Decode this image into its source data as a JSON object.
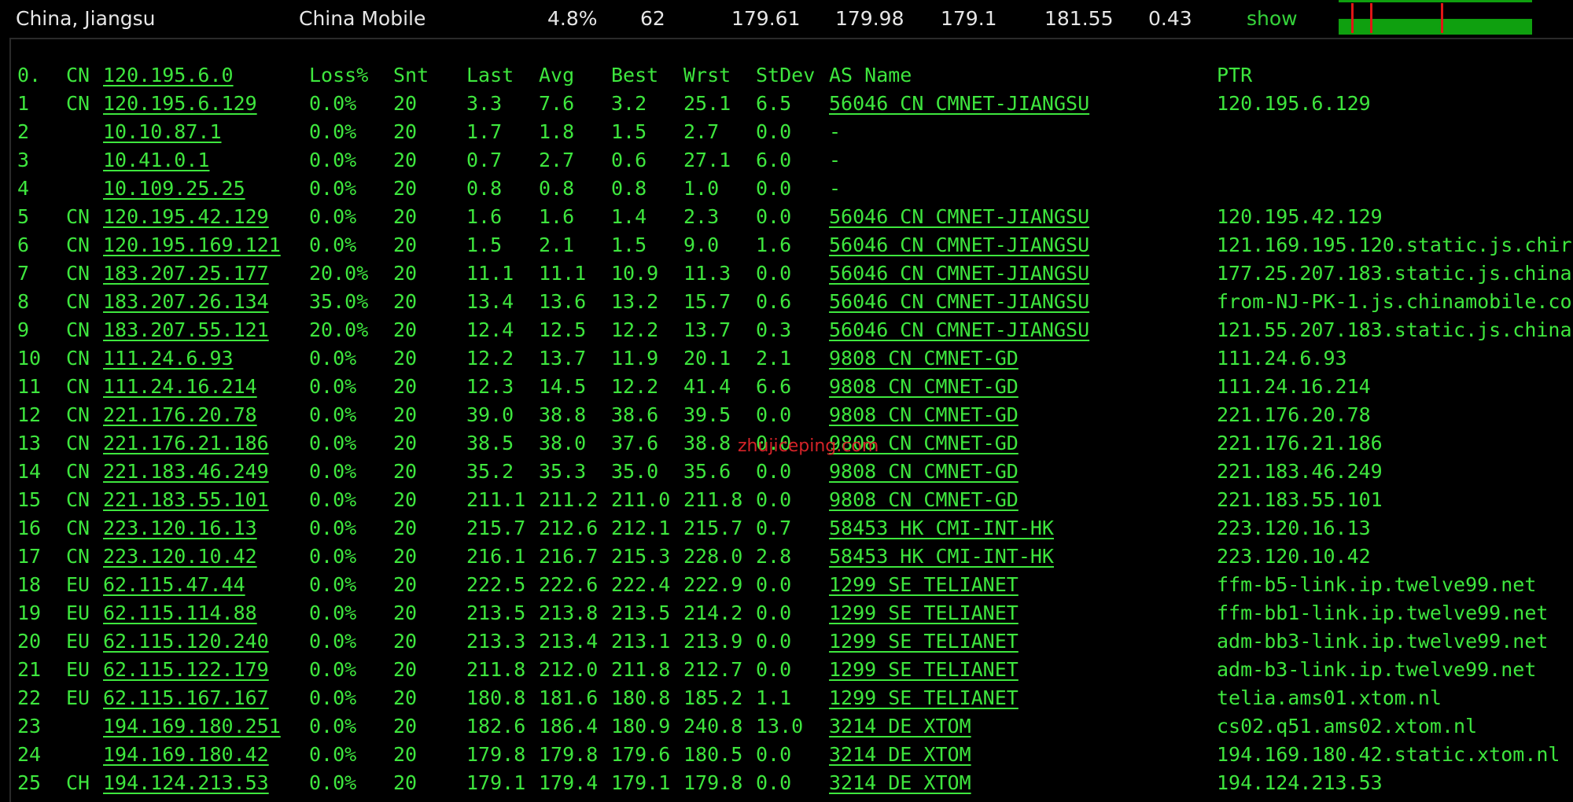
{
  "summary": {
    "location": "China, Jiangsu",
    "isp": "China Mobile",
    "loss": "4.8%",
    "sent": "62",
    "last": "179.61",
    "avg": "179.98",
    "best": "179.1",
    "worst": "181.55",
    "stdev": "0.43",
    "show_label": "show"
  },
  "colors": {
    "text": "#3ee63e",
    "graph_green": "#0fa00f",
    "graph_tick": "#e01616",
    "watermark": "#e0252b"
  },
  "header": {
    "num": "0.",
    "cc": "CN",
    "ip": "120.195.6.0",
    "loss": "Loss%",
    "snt": "Snt",
    "last": "Last",
    "avg": "Avg",
    "best": "Best",
    "wrst": "Wrst",
    "stdev": "StDev",
    "as": "AS Name",
    "ptr": "PTR"
  },
  "hops": [
    {
      "num": "1",
      "cc": "CN",
      "ip": "120.195.6.129",
      "loss": "0.0%",
      "snt": "20",
      "last": "3.3",
      "avg": "7.6",
      "best": "3.2",
      "wrst": "25.1",
      "stdev": "6.5",
      "as": "56046 CN CMNET-JIANGSU",
      "ptr": "120.195.6.129"
    },
    {
      "num": "2",
      "cc": "",
      "ip": "10.10.87.1",
      "loss": "0.0%",
      "snt": "20",
      "last": "1.7",
      "avg": "1.8",
      "best": "1.5",
      "wrst": "2.7",
      "stdev": "0.0",
      "as": "-",
      "ptr": ""
    },
    {
      "num": "3",
      "cc": "",
      "ip": "10.41.0.1",
      "loss": "0.0%",
      "snt": "20",
      "last": "0.7",
      "avg": "2.7",
      "best": "0.6",
      "wrst": "27.1",
      "stdev": "6.0",
      "as": "-",
      "ptr": ""
    },
    {
      "num": "4",
      "cc": "",
      "ip": "10.109.25.25",
      "loss": "0.0%",
      "snt": "20",
      "last": "0.8",
      "avg": "0.8",
      "best": "0.8",
      "wrst": "1.0",
      "stdev": "0.0",
      "as": "-",
      "ptr": ""
    },
    {
      "num": "5",
      "cc": "CN",
      "ip": "120.195.42.129",
      "loss": "0.0%",
      "snt": "20",
      "last": "1.6",
      "avg": "1.6",
      "best": "1.4",
      "wrst": "2.3",
      "stdev": "0.0",
      "as": "56046 CN CMNET-JIANGSU",
      "ptr": "120.195.42.129"
    },
    {
      "num": "6",
      "cc": "CN",
      "ip": "120.195.169.121",
      "loss": "0.0%",
      "snt": "20",
      "last": "1.5",
      "avg": "2.1",
      "best": "1.5",
      "wrst": "9.0",
      "stdev": "1.6",
      "as": "56046 CN CMNET-JIANGSU",
      "ptr": "121.169.195.120.static.js.chir"
    },
    {
      "num": "7",
      "cc": "CN",
      "ip": "183.207.25.177",
      "loss": "20.0%",
      "snt": "20",
      "last": "11.1",
      "avg": "11.1",
      "best": "10.9",
      "wrst": "11.3",
      "stdev": "0.0",
      "as": "56046 CN CMNET-JIANGSU",
      "ptr": "177.25.207.183.static.js.china"
    },
    {
      "num": "8",
      "cc": "CN",
      "ip": "183.207.26.134",
      "loss": "35.0%",
      "snt": "20",
      "last": "13.4",
      "avg": "13.6",
      "best": "13.2",
      "wrst": "15.7",
      "stdev": "0.6",
      "as": "56046 CN CMNET-JIANGSU",
      "ptr": "from-NJ-PK-1.js.chinamobile.co"
    },
    {
      "num": "9",
      "cc": "CN",
      "ip": "183.207.55.121",
      "loss": "20.0%",
      "snt": "20",
      "last": "12.4",
      "avg": "12.5",
      "best": "12.2",
      "wrst": "13.7",
      "stdev": "0.3",
      "as": "56046 CN CMNET-JIANGSU",
      "ptr": "121.55.207.183.static.js.china"
    },
    {
      "num": "10",
      "cc": "CN",
      "ip": "111.24.6.93",
      "loss": "0.0%",
      "snt": "20",
      "last": "12.2",
      "avg": "13.7",
      "best": "11.9",
      "wrst": "20.1",
      "stdev": "2.1",
      "as": "9808  CN CMNET-GD",
      "ptr": "111.24.6.93"
    },
    {
      "num": "11",
      "cc": "CN",
      "ip": "111.24.16.214",
      "loss": "0.0%",
      "snt": "20",
      "last": "12.3",
      "avg": "14.5",
      "best": "12.2",
      "wrst": "41.4",
      "stdev": "6.6",
      "as": "9808  CN CMNET-GD",
      "ptr": "111.24.16.214"
    },
    {
      "num": "12",
      "cc": "CN",
      "ip": "221.176.20.78",
      "loss": "0.0%",
      "snt": "20",
      "last": "39.0",
      "avg": "38.8",
      "best": "38.6",
      "wrst": "39.5",
      "stdev": "0.0",
      "as": "9808  CN CMNET-GD",
      "ptr": "221.176.20.78"
    },
    {
      "num": "13",
      "cc": "CN",
      "ip": "221.176.21.186",
      "loss": "0.0%",
      "snt": "20",
      "last": "38.5",
      "avg": "38.0",
      "best": "37.6",
      "wrst": "38.8",
      "stdev": "0.0",
      "as": "9808  CN CMNET-GD",
      "ptr": "221.176.21.186"
    },
    {
      "num": "14",
      "cc": "CN",
      "ip": "221.183.46.249",
      "loss": "0.0%",
      "snt": "20",
      "last": "35.2",
      "avg": "35.3",
      "best": "35.0",
      "wrst": "35.6",
      "stdev": "0.0",
      "as": "9808  CN CMNET-GD",
      "ptr": "221.183.46.249"
    },
    {
      "num": "15",
      "cc": "CN",
      "ip": "221.183.55.101",
      "loss": "0.0%",
      "snt": "20",
      "last": "211.1",
      "avg": "211.2",
      "best": "211.0",
      "wrst": "211.8",
      "stdev": "0.0",
      "as": "9808  CN CMNET-GD",
      "ptr": "221.183.55.101"
    },
    {
      "num": "16",
      "cc": "CN",
      "ip": "223.120.16.13",
      "loss": "0.0%",
      "snt": "20",
      "last": "215.7",
      "avg": "212.6",
      "best": "212.1",
      "wrst": "215.7",
      "stdev": "0.7",
      "as": "58453 HK CMI-INT-HK",
      "ptr": "223.120.16.13"
    },
    {
      "num": "17",
      "cc": "CN",
      "ip": "223.120.10.42",
      "loss": "0.0%",
      "snt": "20",
      "last": "216.1",
      "avg": "216.7",
      "best": "215.3",
      "wrst": "228.0",
      "stdev": "2.8",
      "as": "58453 HK CMI-INT-HK",
      "ptr": "223.120.10.42"
    },
    {
      "num": "18",
      "cc": "EU",
      "ip": "62.115.47.44",
      "loss": "0.0%",
      "snt": "20",
      "last": "222.5",
      "avg": "222.6",
      "best": "222.4",
      "wrst": "222.9",
      "stdev": "0.0",
      "as": "1299  SE TELIANET",
      "ptr": "ffm-b5-link.ip.twelve99.net"
    },
    {
      "num": "19",
      "cc": "EU",
      "ip": "62.115.114.88",
      "loss": "0.0%",
      "snt": "20",
      "last": "213.5",
      "avg": "213.8",
      "best": "213.5",
      "wrst": "214.2",
      "stdev": "0.0",
      "as": "1299  SE TELIANET",
      "ptr": "ffm-bb1-link.ip.twelve99.net"
    },
    {
      "num": "20",
      "cc": "EU",
      "ip": "62.115.120.240",
      "loss": "0.0%",
      "snt": "20",
      "last": "213.3",
      "avg": "213.4",
      "best": "213.1",
      "wrst": "213.9",
      "stdev": "0.0",
      "as": "1299  SE TELIANET",
      "ptr": "adm-bb3-link.ip.twelve99.net"
    },
    {
      "num": "21",
      "cc": "EU",
      "ip": "62.115.122.179",
      "loss": "0.0%",
      "snt": "20",
      "last": "211.8",
      "avg": "212.0",
      "best": "211.8",
      "wrst": "212.7",
      "stdev": "0.0",
      "as": "1299  SE TELIANET",
      "ptr": "adm-b3-link.ip.twelve99.net"
    },
    {
      "num": "22",
      "cc": "EU",
      "ip": "62.115.167.167",
      "loss": "0.0%",
      "snt": "20",
      "last": "180.8",
      "avg": "181.6",
      "best": "180.8",
      "wrst": "185.2",
      "stdev": "1.1",
      "as": "1299  SE TELIANET",
      "ptr": "telia.ams01.xtom.nl"
    },
    {
      "num": "23",
      "cc": "",
      "ip": "194.169.180.251",
      "loss": "0.0%",
      "snt": "20",
      "last": "182.6",
      "avg": "186.4",
      "best": "180.9",
      "wrst": "240.8",
      "stdev": "13.0",
      "as": "3214  DE XTOM",
      "ptr": "cs02.q51.ams02.xtom.nl"
    },
    {
      "num": "24",
      "cc": "",
      "ip": "194.169.180.42",
      "loss": "0.0%",
      "snt": "20",
      "last": "179.8",
      "avg": "179.8",
      "best": "179.6",
      "wrst": "180.5",
      "stdev": "0.0",
      "as": "3214  DE XTOM",
      "ptr": "194.169.180.42.static.xtom.nl"
    },
    {
      "num": "25",
      "cc": "CH",
      "ip": "194.124.213.53",
      "loss": "0.0%",
      "snt": "20",
      "last": "179.1",
      "avg": "179.4",
      "best": "179.1",
      "wrst": "179.8",
      "stdev": "0.0",
      "as": "3214  DE XTOM",
      "ptr": "194.124.213.53"
    }
  ],
  "watermark": "zhujiceping.com"
}
